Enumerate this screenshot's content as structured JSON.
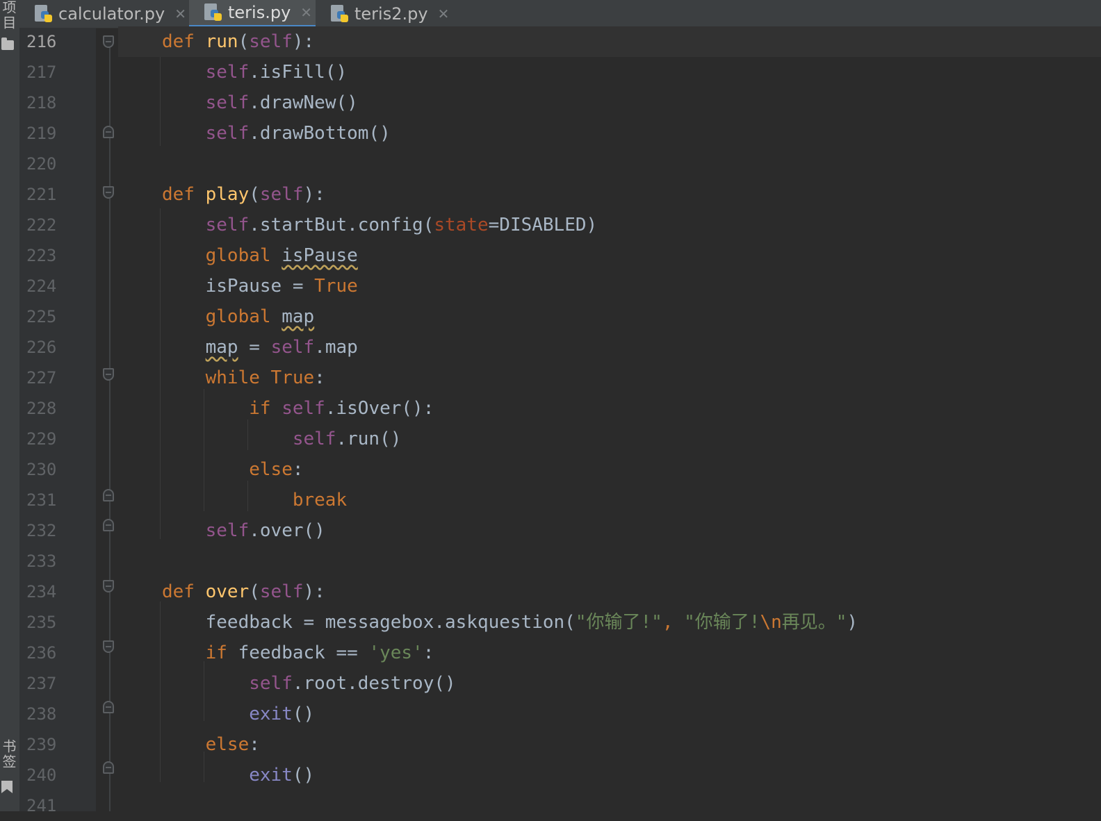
{
  "sidebar": {
    "project_label": "项目",
    "bookmarks_label": "书签"
  },
  "tabs": [
    {
      "label": "calculator.py",
      "active": false
    },
    {
      "label": "teris.py",
      "active": true
    },
    {
      "label": "teris2.py",
      "active": false
    }
  ],
  "gutter": {
    "line_numbers": [
      "216",
      "217",
      "218",
      "219",
      "220",
      "221",
      "222",
      "223",
      "224",
      "225",
      "226",
      "227",
      "228",
      "229",
      "230",
      "231",
      "232",
      "233",
      "234",
      "235",
      "236",
      "237",
      "238",
      "239",
      "240",
      "241"
    ]
  },
  "editor": {
    "current_line": "216",
    "lines": [
      [
        {
          "t": "def ",
          "c": "kw"
        },
        {
          "t": "run",
          "c": "fn"
        },
        {
          "t": "(",
          "c": "plain"
        },
        {
          "t": "self",
          "c": "self"
        },
        {
          "t": "):",
          "c": "plain"
        }
      ],
      [
        {
          "t": "    "
        },
        {
          "t": "self",
          "c": "self"
        },
        {
          "t": ".isFill()",
          "c": "plain"
        }
      ],
      [
        {
          "t": "    "
        },
        {
          "t": "self",
          "c": "self"
        },
        {
          "t": ".drawNew()",
          "c": "plain"
        }
      ],
      [
        {
          "t": "    "
        },
        {
          "t": "self",
          "c": "self"
        },
        {
          "t": ".drawBottom()",
          "c": "plain"
        }
      ],
      [],
      [
        {
          "t": "def ",
          "c": "kw"
        },
        {
          "t": "play",
          "c": "fn"
        },
        {
          "t": "(",
          "c": "plain"
        },
        {
          "t": "self",
          "c": "self"
        },
        {
          "t": "):",
          "c": "plain"
        }
      ],
      [
        {
          "t": "    "
        },
        {
          "t": "self",
          "c": "self"
        },
        {
          "t": ".startBut.config(",
          "c": "plain"
        },
        {
          "t": "state",
          "c": "par"
        },
        {
          "t": "=DISABLED)",
          "c": "plain"
        }
      ],
      [
        {
          "t": "    "
        },
        {
          "t": "global ",
          "c": "kw"
        },
        {
          "t": "isPause",
          "c": "plain",
          "w": true
        }
      ],
      [
        {
          "t": "    "
        },
        {
          "t": "isPause = ",
          "c": "plain"
        },
        {
          "t": "True",
          "c": "kw"
        }
      ],
      [
        {
          "t": "    "
        },
        {
          "t": "global ",
          "c": "kw"
        },
        {
          "t": "map",
          "c": "plain",
          "w": true
        }
      ],
      [
        {
          "t": "    "
        },
        {
          "t": "map",
          "c": "plain",
          "w": true
        },
        {
          "t": " = ",
          "c": "plain"
        },
        {
          "t": "self",
          "c": "self"
        },
        {
          "t": ".map",
          "c": "plain"
        }
      ],
      [
        {
          "t": "    "
        },
        {
          "t": "while ",
          "c": "kw"
        },
        {
          "t": "True",
          "c": "kw"
        },
        {
          "t": ":",
          "c": "plain"
        }
      ],
      [
        {
          "t": "        "
        },
        {
          "t": "if ",
          "c": "kw"
        },
        {
          "t": "self",
          "c": "self"
        },
        {
          "t": ".isOver():",
          "c": "plain"
        }
      ],
      [
        {
          "t": "            "
        },
        {
          "t": "self",
          "c": "self"
        },
        {
          "t": ".run()",
          "c": "plain"
        }
      ],
      [
        {
          "t": "        "
        },
        {
          "t": "else",
          "c": "kw"
        },
        {
          "t": ":",
          "c": "plain"
        }
      ],
      [
        {
          "t": "            "
        },
        {
          "t": "break",
          "c": "kw"
        }
      ],
      [
        {
          "t": "    "
        },
        {
          "t": "self",
          "c": "self"
        },
        {
          "t": ".over()",
          "c": "plain"
        }
      ],
      [],
      [
        {
          "t": "def ",
          "c": "kw"
        },
        {
          "t": "over",
          "c": "fn"
        },
        {
          "t": "(",
          "c": "plain"
        },
        {
          "t": "self",
          "c": "self"
        },
        {
          "t": "):",
          "c": "plain"
        }
      ],
      [
        {
          "t": "    "
        },
        {
          "t": "feedback = messagebox.askquestion(",
          "c": "plain"
        },
        {
          "t": "\"你输了!\"",
          "c": "str"
        },
        {
          "t": ", ",
          "c": "kw"
        },
        {
          "t": "\"你输了!",
          "c": "str"
        },
        {
          "t": "\\n",
          "c": "esc"
        },
        {
          "t": "再见。\"",
          "c": "str"
        },
        {
          "t": ")",
          "c": "plain"
        }
      ],
      [
        {
          "t": "    "
        },
        {
          "t": "if ",
          "c": "kw"
        },
        {
          "t": "feedback == ",
          "c": "plain"
        },
        {
          "t": "'yes'",
          "c": "str"
        },
        {
          "t": ":",
          "c": "plain"
        }
      ],
      [
        {
          "t": "        "
        },
        {
          "t": "self",
          "c": "self"
        },
        {
          "t": ".root.destroy()",
          "c": "plain"
        }
      ],
      [
        {
          "t": "        "
        },
        {
          "t": "exit",
          "c": "bi"
        },
        {
          "t": "()",
          "c": "plain"
        }
      ],
      [
        {
          "t": "    "
        },
        {
          "t": "else",
          "c": "kw"
        },
        {
          "t": ":",
          "c": "plain"
        }
      ],
      [
        {
          "t": "        "
        },
        {
          "t": "exit",
          "c": "bi"
        },
        {
          "t": "()",
          "c": "plain"
        }
      ],
      []
    ]
  },
  "colors": {
    "keyword": "#cc7832",
    "function_name": "#ffc66d",
    "self": "#94558d",
    "parameter": "#aa4926",
    "string": "#6a8759",
    "builtin": "#8888c6",
    "text": "#a9b7c6",
    "line_number": "#606366",
    "tab_active_underline": "#4a88c7"
  }
}
